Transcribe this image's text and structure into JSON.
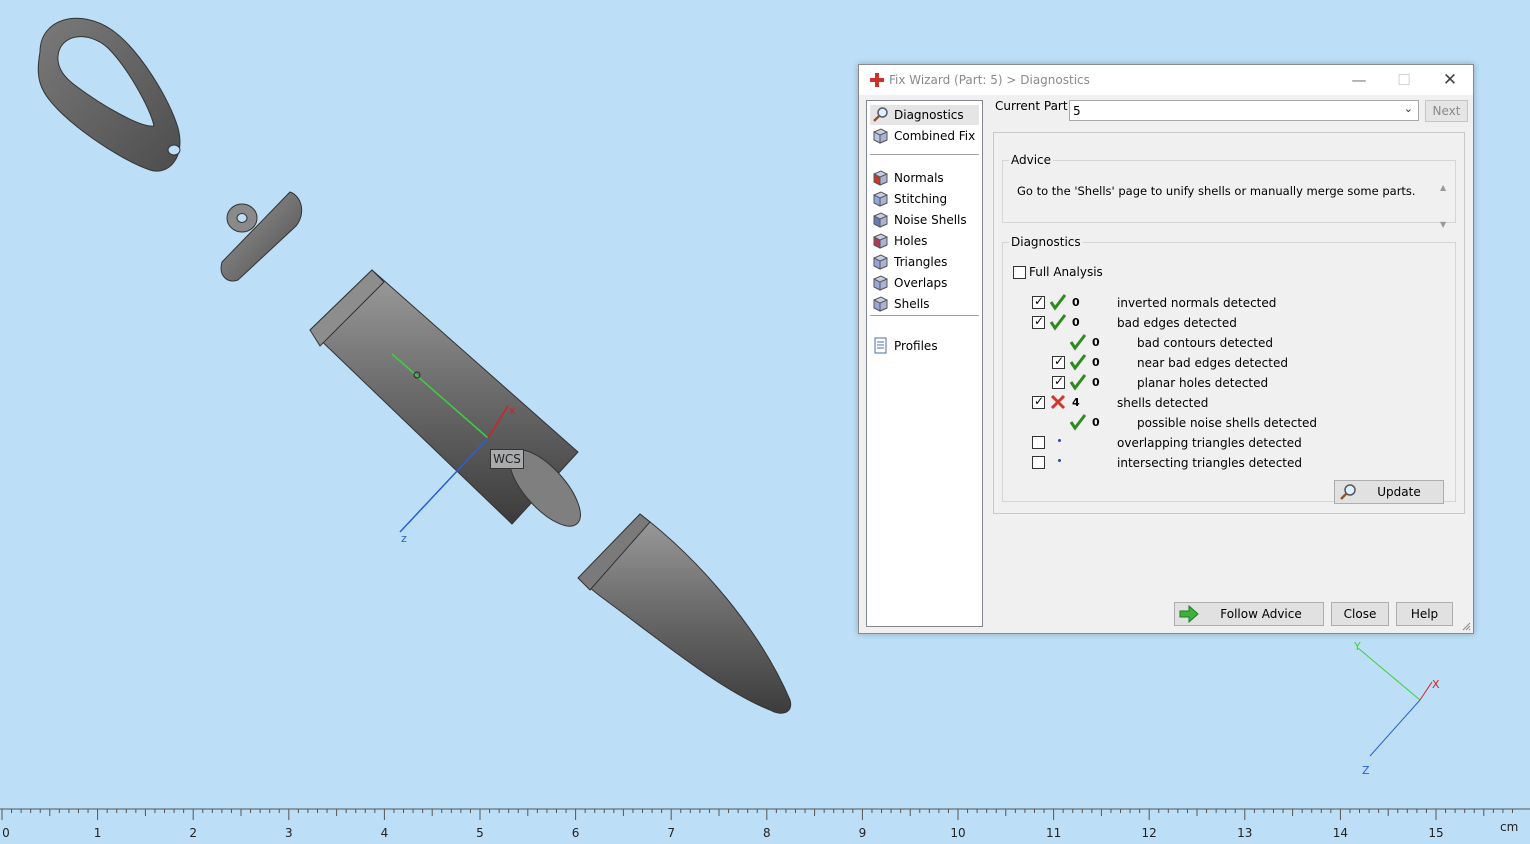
{
  "dialog": {
    "title": "Fix Wizard (Part: 5) > Diagnostics",
    "current_part_label": "Current Part:",
    "current_part_value": "5",
    "next_label": "Next",
    "nav": [
      {
        "label": "Diagnostics",
        "icon": "magnifier-icon",
        "selected": true
      },
      {
        "label": "Combined Fix",
        "icon": "cube-icon"
      },
      {
        "label": "Normals",
        "icon": "normals-cube-icon"
      },
      {
        "label": "Stitching",
        "icon": "stitching-cube-icon"
      },
      {
        "label": "Noise Shells",
        "icon": "noise-cube-icon"
      },
      {
        "label": "Holes",
        "icon": "holes-cube-icon"
      },
      {
        "label": "Triangles",
        "icon": "triangles-cube-icon"
      },
      {
        "label": "Overlaps",
        "icon": "overlaps-cube-icon"
      },
      {
        "label": "Shells",
        "icon": "shells-cube-icon"
      },
      {
        "label": "Profiles",
        "icon": "document-icon"
      }
    ],
    "advice": {
      "label": "Advice",
      "text": "Go to the 'Shells' page to unify shells or manually merge some parts."
    },
    "diagnostics": {
      "label": "Diagnostics",
      "full_analysis_label": "Full Analysis",
      "full_analysis_checked": false,
      "rows": [
        {
          "checked": true,
          "has_checkbox": true,
          "status": "ok",
          "count": "0",
          "label": "inverted normals detected",
          "indent": 0
        },
        {
          "checked": true,
          "has_checkbox": true,
          "status": "ok",
          "count": "0",
          "label": "bad edges detected",
          "indent": 0
        },
        {
          "checked": false,
          "has_checkbox": false,
          "status": "ok",
          "count": "0",
          "label": "bad contours detected",
          "indent": 1
        },
        {
          "checked": true,
          "has_checkbox": true,
          "status": "ok",
          "count": "0",
          "label": "near bad edges detected",
          "indent": 1
        },
        {
          "checked": true,
          "has_checkbox": true,
          "status": "ok",
          "count": "0",
          "label": "planar holes detected",
          "indent": 1
        },
        {
          "checked": true,
          "has_checkbox": true,
          "status": "error",
          "count": "4",
          "label": "shells detected",
          "indent": 0
        },
        {
          "checked": false,
          "has_checkbox": false,
          "status": "ok",
          "count": "0",
          "label": "possible noise shells detected",
          "indent": 1
        },
        {
          "checked": false,
          "has_checkbox": true,
          "status": "none",
          "count": "",
          "label": "overlapping triangles detected",
          "indent": 0
        },
        {
          "checked": false,
          "has_checkbox": true,
          "status": "none",
          "count": "",
          "label": "intersecting triangles detected",
          "indent": 0
        }
      ],
      "update_label": "Update"
    },
    "follow_advice_label": "Follow Advice",
    "close_label": "Close",
    "help_label": "Help"
  },
  "viewport": {
    "wcs_label": "WCS",
    "wcs_axes": {
      "x": "x",
      "z": "z"
    },
    "corner_axes": {
      "y": "Y",
      "x": "X",
      "z": "Z"
    }
  },
  "ruler": {
    "unit": "cm",
    "labels": [
      "0",
      "1",
      "2",
      "3",
      "4",
      "5",
      "6",
      "7",
      "8",
      "9",
      "10",
      "11",
      "12",
      "13",
      "14",
      "15"
    ]
  },
  "colors": {
    "background": "#bcdff7",
    "ok_check": "#2e8b1f",
    "error_cross": "#d0362b",
    "x_axis": "#d42020",
    "y_axis": "#3ecf3e",
    "z_axis": "#2a5fd6"
  }
}
